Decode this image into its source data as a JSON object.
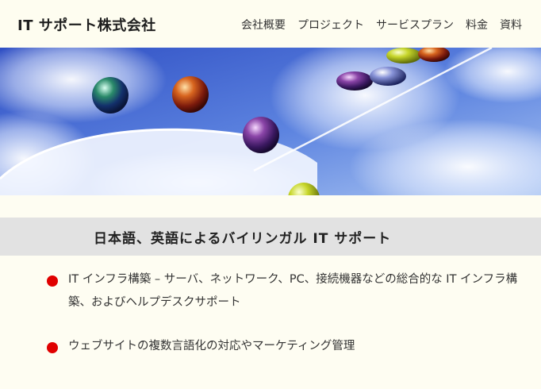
{
  "header": {
    "brand": "IT サポート株式会社",
    "nav": [
      {
        "label": "会社概要"
      },
      {
        "label": "プロジェクト"
      },
      {
        "label": "サービスプラン"
      },
      {
        "label": "料金"
      },
      {
        "label": "資料"
      }
    ]
  },
  "hero": {
    "image": "blue-sky-marbles-banner"
  },
  "main": {
    "subheading": "日本語、英語によるバイリンガル IT サポート",
    "services": [
      {
        "text": "IT インフラ構築 – サーバ、ネットワーク、PC、接続機器などの総合的な IT インフラ構築、およびヘルプデスクサポート"
      },
      {
        "text": "ウェブサイトの複数言語化の対応やマーケティング管理"
      }
    ]
  },
  "colors": {
    "page_background": "#fefdf2",
    "subheading_band": "#e2e2e2",
    "bullet": "#e00000"
  }
}
